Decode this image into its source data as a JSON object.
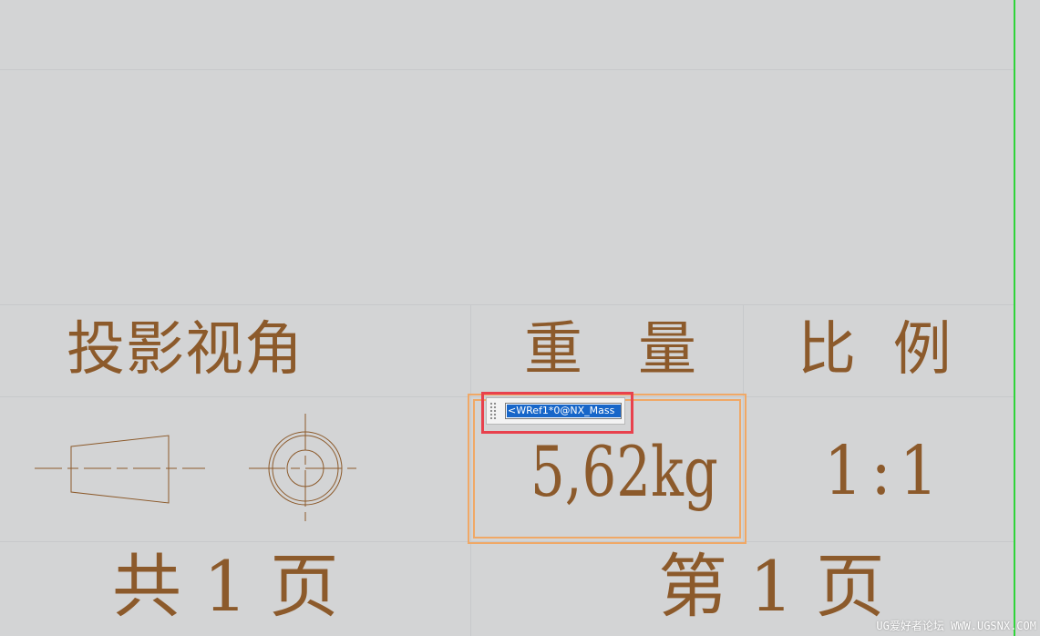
{
  "title_block": {
    "projection_heading": "投影视角",
    "weight_heading": "重   量",
    "scale_heading": "比  例",
    "weight_value": "5,62kg",
    "scale_value": "1:1",
    "total_sheets": "共 1 页",
    "sheet_number": "第 1 页"
  },
  "editor": {
    "value": "<WRef1*0@NX_Mass"
  },
  "watermark": "UG爱好者论坛 WWW.UGSNX.COM",
  "colors": {
    "background": "#d3d4d5",
    "text": "#8c5a2b",
    "selection_outline": "#f0a866",
    "editor_highlight": "#e8414d",
    "border_green": "#2fd43a"
  },
  "icons": {
    "projection_symbol": "first-angle-projection-icon",
    "grip": "drag-grip-icon"
  }
}
